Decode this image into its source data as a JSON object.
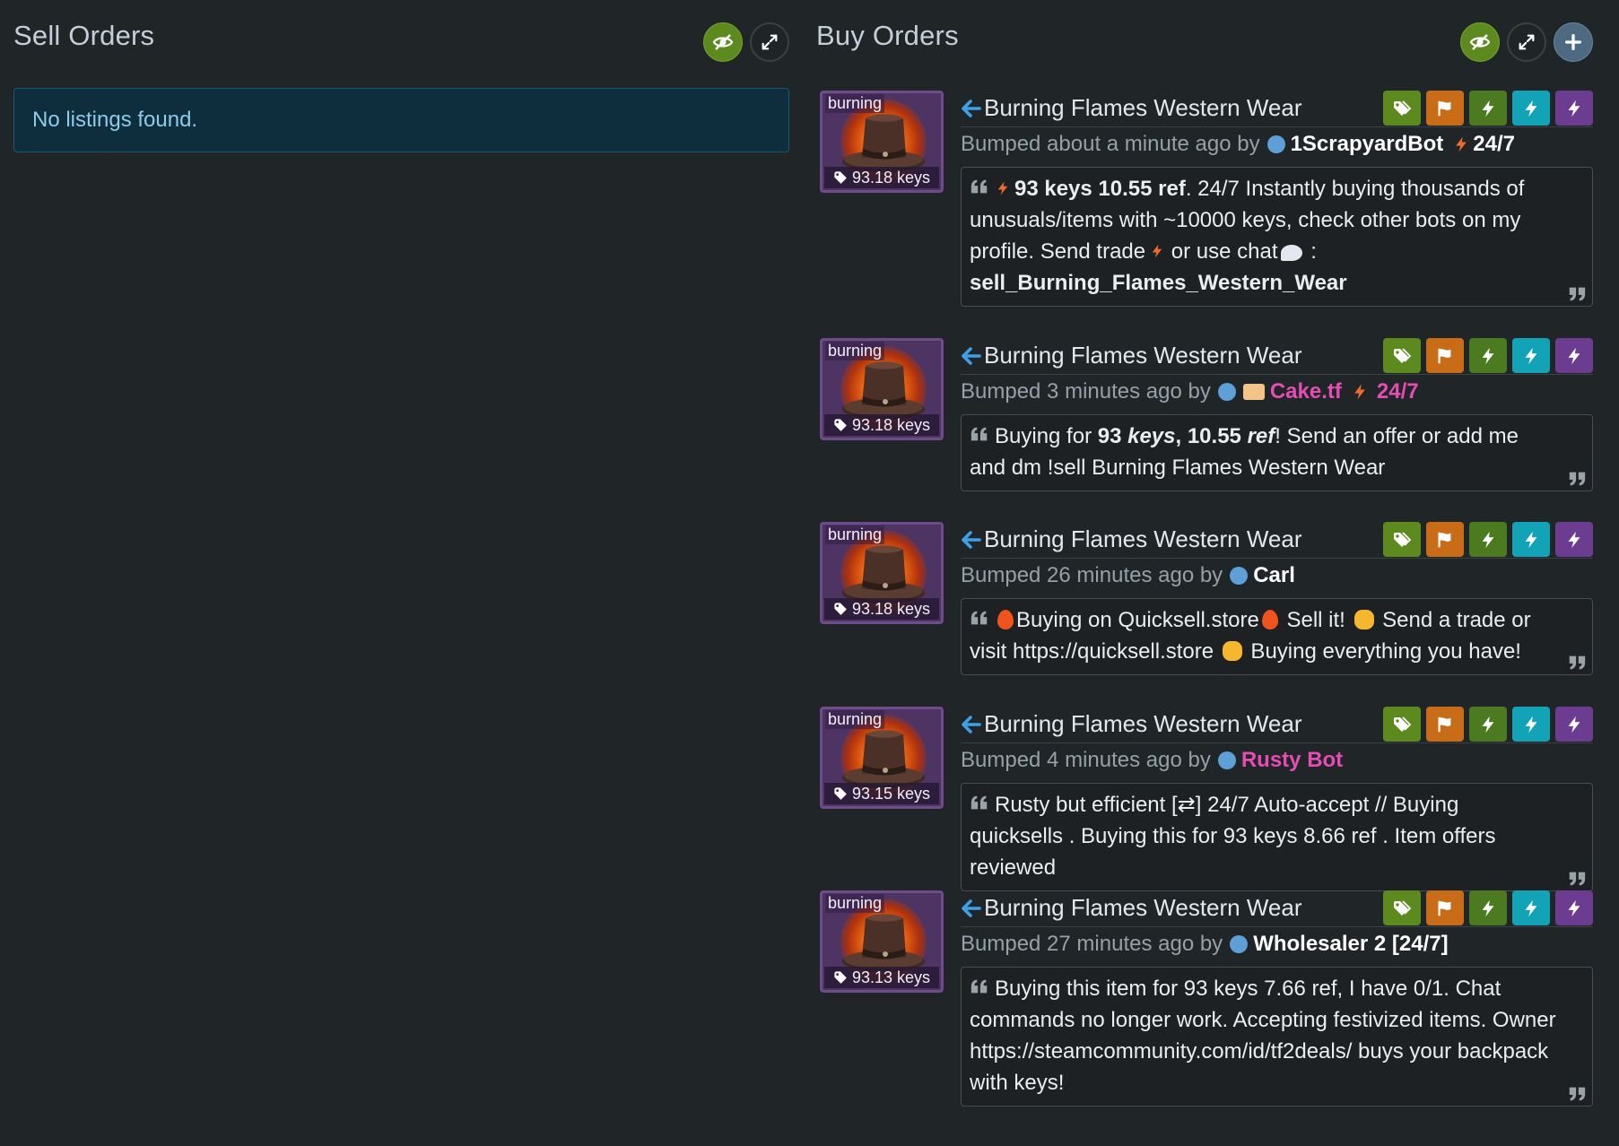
{
  "sell_panel": {
    "title": "Sell Orders",
    "empty_message": "No listings found."
  },
  "buy_panel": {
    "title": "Buy Orders"
  },
  "listings": [
    {
      "thumb_label": "burning",
      "price": "93.18 keys",
      "title": "Burning Flames Western Wear",
      "bumped": "Bumped about a minute ago by",
      "user": "1ScrapyardBot",
      "user_extra": "24/7",
      "q": {
        "a": "93 keys 10.55 ref",
        "b": ". 24/7 Instantly buying thousands of unusuals/items with ~10000 keys, check other bots on my profile. Send  trade",
        "c": " or  use  chat",
        "d": " :",
        "e": "sell_Burning_Flames_Western_Wear"
      }
    },
    {
      "thumb_label": "burning",
      "price": "93.18 keys",
      "title": "Burning Flames Western Wear",
      "bumped": "Bumped 3 minutes ago by",
      "user": "Cake.tf",
      "user_extra": "24/7",
      "q": {
        "a": "Buying for ",
        "b": "93 ",
        "c": "keys",
        "d": ", 10.55 ",
        "e": "ref",
        "f": "! Send an offer or add me and dm !sell Burning Flames Western Wear"
      }
    },
    {
      "thumb_label": "burning",
      "price": "93.18 keys",
      "title": "Burning Flames Western Wear",
      "bumped": "Bumped 26 minutes ago by",
      "user": "Carl",
      "q": {
        "a": "Buying on Quicksell.store",
        "b": " Sell it! ",
        "c": " Send a trade or visit https://quicksell.store ",
        "d": " Buying everything you have!"
      }
    },
    {
      "thumb_label": "burning",
      "price": "93.15 keys",
      "title": "Burning Flames Western Wear",
      "bumped": "Bumped 4 minutes ago by",
      "user": "Rusty Bot",
      "q": {
        "a": "Rusty but efficient [⇄] 24/7 Auto-accept // Buying quicksells . Buying this for 93 keys 8.66 ref . Item offers reviewed"
      }
    },
    {
      "thumb_label": "burning",
      "price": "93.13 keys",
      "title": "Burning Flames Western Wear",
      "bumped": "Bumped 27 minutes ago by",
      "user": "Wholesaler 2 [24/7]",
      "q": {
        "a": "Buying this item for 93 keys 7.66 ref, I have 0/1. Chat commands no longer work. Accepting festivized items. Owner https://steamcommunity.com/id/tf2deals/ buys your backpack with keys!"
      }
    }
  ],
  "colors": {
    "background": "#202527",
    "accent_green": "#5d8a1f",
    "orange": "#c96c17",
    "teal": "#12a3b6",
    "purple": "#6b3c8f",
    "pink_user": "#e64db4",
    "unusual_border": "#6e4c8a"
  },
  "icons": {
    "hide": "eye-slash-icon",
    "expand": "expand-icon",
    "add": "plus-icon",
    "tag": "tags-icon",
    "flag": "flag-icon",
    "bolt": "bolt-icon",
    "arrow": "arrow-left-icon",
    "quote_open": "quote-left-icon",
    "quote_close": "quote-right-icon"
  }
}
